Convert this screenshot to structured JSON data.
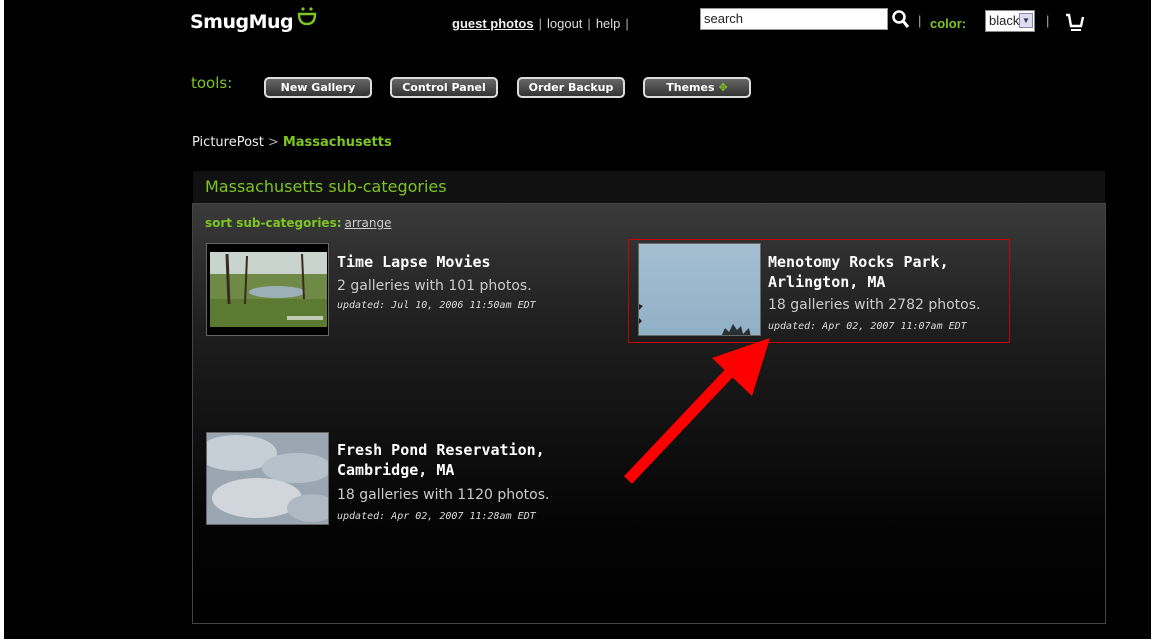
{
  "header": {
    "logo_text": "SmugMug",
    "nav": {
      "guest_photos": "guest photos",
      "logout": "logout",
      "help": "help",
      "sep": "|"
    },
    "search": {
      "value": "search"
    },
    "color": {
      "label": "color:",
      "selected": "black"
    },
    "icons": {
      "search": "search-icon",
      "cart": "cart-icon",
      "logo": "smile-logo-icon"
    }
  },
  "tools": {
    "label": "tools:",
    "buttons": [
      "New Gallery",
      "Control Panel",
      "Order Backup",
      "Themes"
    ]
  },
  "breadcrumb": {
    "root": "PicturePost",
    "sep": ">",
    "current": "Massachusetts"
  },
  "panel": {
    "title": "Massachusetts sub-categories",
    "sort_label": "sort sub-categories:",
    "sort_link": "arrange",
    "categories": [
      {
        "title_line1": "Time Lapse Movies",
        "title_line2": "",
        "count": "2 galleries with 101 photos.",
        "updated": "updated: Jul 10, 2006 11:50am EDT"
      },
      {
        "title_line1": "Menotomy Rocks Park,",
        "title_line2": "Arlington, MA",
        "count": "18 galleries with 2782 photos.",
        "updated": "updated: Apr 02, 2007 11:07am EDT"
      },
      {
        "title_line1": "Fresh Pond Reservation,",
        "title_line2": "Cambridge, MA",
        "count": "18 galleries with 1120 photos.",
        "updated": "updated: Apr 02, 2007 11:28am EDT"
      }
    ]
  },
  "colors": {
    "accent_green": "#7dc621",
    "highlight_red": "#cc0000",
    "arrow_red": "#ff0000",
    "background": "#000000"
  }
}
